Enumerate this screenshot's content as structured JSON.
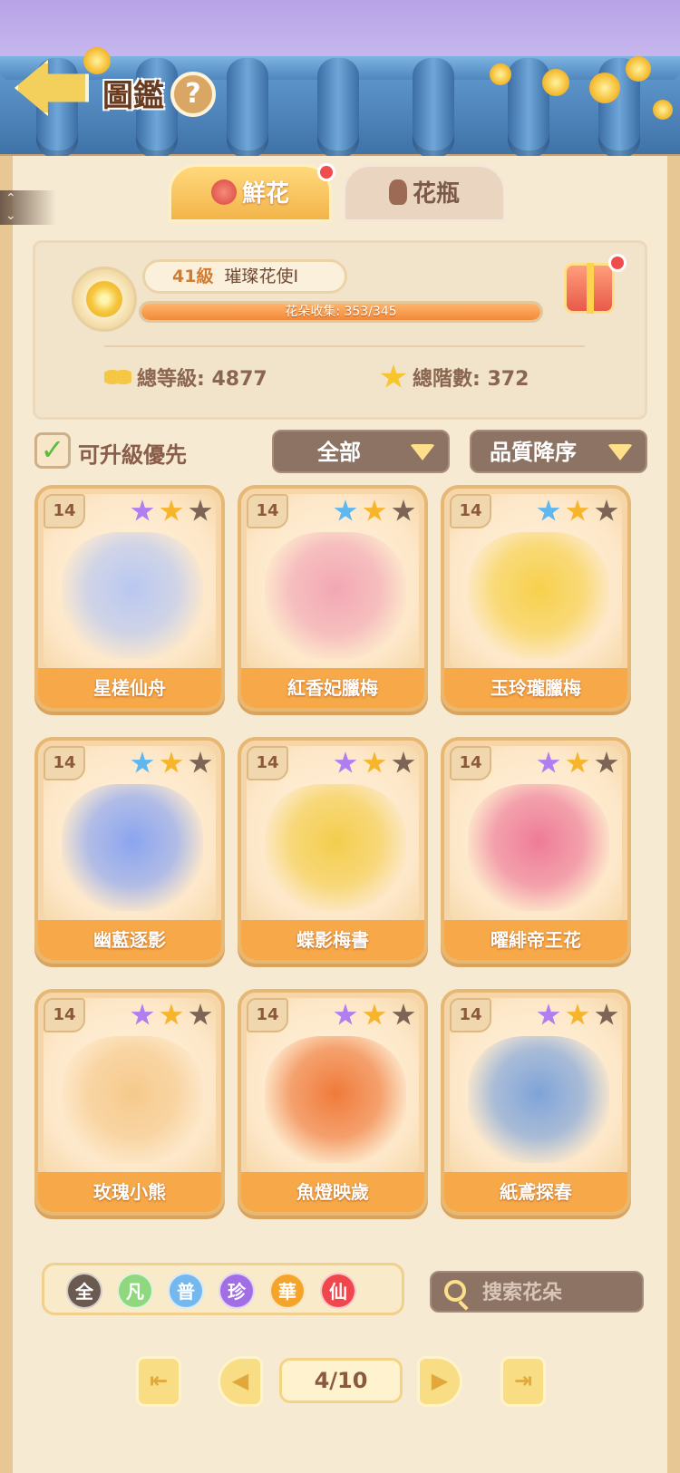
{
  "header": {
    "title": "圖鑑",
    "help_label": "?"
  },
  "tabs": [
    {
      "label": "鮮花",
      "active": true,
      "has_badge": true
    },
    {
      "label": "花瓶",
      "active": false,
      "has_badge": false
    }
  ],
  "profile": {
    "level_text": "41級",
    "rank_title": "璀璨花使I",
    "collection_label": "花朵收集: 353/345",
    "collection_progress": 1.0,
    "total_level_label": "總等級:",
    "total_level_value": "4877",
    "total_stars_label": "總階數:",
    "total_stars_value": "372"
  },
  "filters": {
    "upgrade_first_label": "可升級優先",
    "upgrade_first_checked": true,
    "category_selected": "全部",
    "sort_selected": "品質降序"
  },
  "colors": {
    "purple_star": "#b07ef0",
    "blue_star": "#5fb7f0",
    "gold_star": "#f7b52c",
    "gray_star": "#7c6556"
  },
  "cards": [
    {
      "level": "14",
      "name": "星槎仙舟",
      "stars": [
        "purple_star",
        "gold_star",
        "gray_star"
      ],
      "art_color": "#b9c7f0"
    },
    {
      "level": "14",
      "name": "紅香妃臘梅",
      "stars": [
        "blue_star",
        "gold_star",
        "gray_star"
      ],
      "art_color": "#f2a7b3"
    },
    {
      "level": "14",
      "name": "玉玲瓏臘梅",
      "stars": [
        "blue_star",
        "gold_star",
        "gray_star"
      ],
      "art_color": "#f7d04b"
    },
    {
      "level": "14",
      "name": "幽藍逐影",
      "stars": [
        "blue_star",
        "gold_star",
        "gray_star"
      ],
      "art_color": "#8ba4ef"
    },
    {
      "level": "14",
      "name": "蝶影梅書",
      "stars": [
        "purple_star",
        "gold_star",
        "gray_star"
      ],
      "art_color": "#f4cd4c"
    },
    {
      "level": "14",
      "name": "曜緋帝王花",
      "stars": [
        "purple_star",
        "gold_star",
        "gray_star"
      ],
      "art_color": "#ee7b97"
    },
    {
      "level": "14",
      "name": "玫瑰小熊",
      "stars": [
        "purple_star",
        "gold_star",
        "gray_star"
      ],
      "art_color": "#f6c98b"
    },
    {
      "level": "14",
      "name": "魚燈映歲",
      "stars": [
        "purple_star",
        "gold_star",
        "gray_star"
      ],
      "art_color": "#f07a3a"
    },
    {
      "level": "14",
      "name": "紙鳶探春",
      "stars": [
        "purple_star",
        "gold_star",
        "gray_star"
      ],
      "art_color": "#7fa3d8"
    }
  ],
  "quality_filters": [
    {
      "label": "全",
      "color": "#6b5a50"
    },
    {
      "label": "凡",
      "color": "#8fd880"
    },
    {
      "label": "普",
      "color": "#74b8ee"
    },
    {
      "label": "珍",
      "color": "#a26ee3"
    },
    {
      "label": "華",
      "color": "#f5a42b"
    },
    {
      "label": "仙",
      "color": "#f0474d"
    }
  ],
  "search": {
    "placeholder": "搜索花朵"
  },
  "pagination": {
    "current": "4/10"
  }
}
